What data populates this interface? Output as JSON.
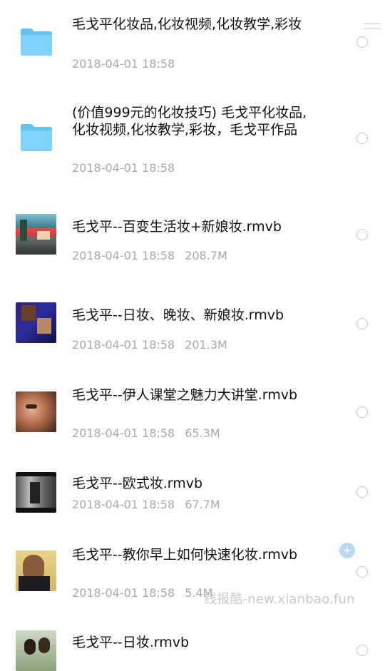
{
  "items": [
    {
      "type": "folder",
      "title": "毛戈平化妆品,化妆视频,化妆教学,彩妆",
      "date": "2018-04-01 18:58",
      "size": ""
    },
    {
      "type": "folder",
      "title": "(价值999元的化妆技巧) 毛戈平化妆品,化妆视频,化妆教学,彩妆，毛戈平作品",
      "date": "2018-04-01 18:58",
      "size": ""
    },
    {
      "type": "video",
      "title": "毛戈平--百变生活妆+新娘妆.rmvb",
      "date": "2018-04-01 18:58",
      "size": "208.7M"
    },
    {
      "type": "video",
      "title": "毛戈平--日妆、晚妆、新娘妆.rmvb",
      "date": "2018-04-01 18:58",
      "size": "201.3M"
    },
    {
      "type": "video",
      "title": "毛戈平--伊人课堂之魅力大讲堂.rmvb",
      "date": "2018-04-01 18:58",
      "size": "65.3M"
    },
    {
      "type": "video",
      "title": "毛戈平--欧式妆.rmvb",
      "date": "2018-04-01 18:58",
      "size": "67.7M"
    },
    {
      "type": "video",
      "title": "毛戈平--教你早上如何快速化妆.rmvb",
      "date": "2018-04-01 18:58",
      "size": "5.4M"
    },
    {
      "type": "video",
      "title": "毛戈平--日妆.rmvb",
      "date": "",
      "size": ""
    }
  ],
  "watermark": "线报酷-new.xianbao.fun",
  "colors": {
    "folder": "#5ac8fa",
    "meta": "#a6a9b0",
    "radio": "#c8c8cc"
  }
}
